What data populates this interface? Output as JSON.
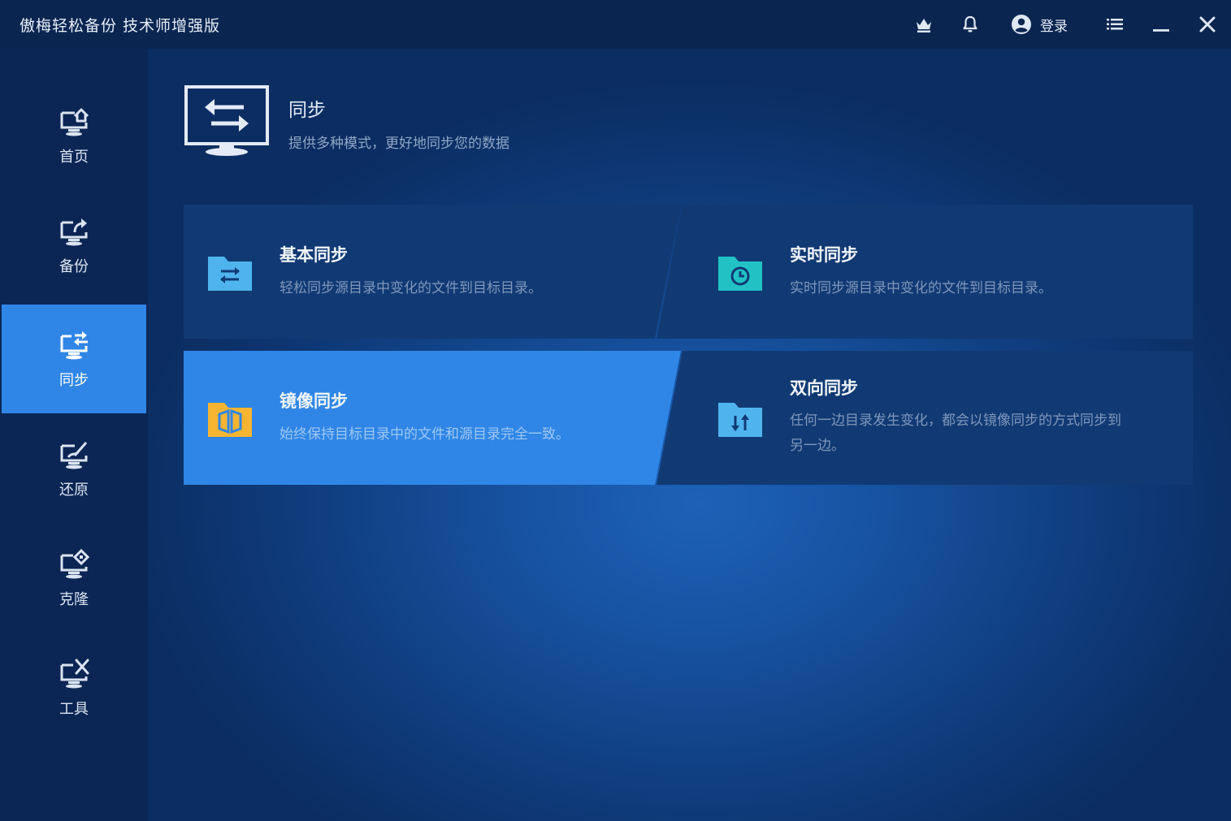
{
  "app": {
    "title": "傲梅轻松备份 技术师增强版"
  },
  "titlebar": {
    "login_label": "登录",
    "icons": [
      "crown-icon",
      "bell-icon",
      "user-icon",
      "menu-icon",
      "minimize-icon",
      "close-icon"
    ]
  },
  "sidebar": {
    "active_index": 2,
    "items": [
      {
        "label": "首页",
        "icon": "home-icon"
      },
      {
        "label": "备份",
        "icon": "backup-icon"
      },
      {
        "label": "同步",
        "icon": "sync-icon"
      },
      {
        "label": "还原",
        "icon": "restore-icon"
      },
      {
        "label": "克隆",
        "icon": "clone-icon"
      },
      {
        "label": "工具",
        "icon": "tools-icon"
      }
    ]
  },
  "header": {
    "title": "同步",
    "subtitle": "提供多种模式，更好地同步您的数据"
  },
  "cards": [
    {
      "title": "基本同步",
      "desc": "轻松同步源目录中变化的文件到目标目录。",
      "icon": "basic-sync-folder-icon",
      "color": "#4fb4ee"
    },
    {
      "title": "实时同步",
      "desc": "实时同步源目录中变化的文件到目标目录。",
      "icon": "realtime-sync-folder-icon",
      "color": "#22c2c4"
    },
    {
      "title": "镜像同步",
      "desc": "始终保持目标目录中的文件和源目录完全一致。",
      "icon": "mirror-sync-folder-icon",
      "color": "#f5b531"
    },
    {
      "title": "双向同步",
      "desc_line1": "任何一边目录发生变化，都会以镜像同步的方式同步到",
      "desc_line2": "另一边。",
      "icon": "two-way-sync-folder-icon",
      "color": "#4fb4ee"
    }
  ],
  "colors": {
    "accent": "#2f86e6",
    "sidebar_bg": "#0b2654",
    "titlebar_bg": "#0a2550"
  }
}
